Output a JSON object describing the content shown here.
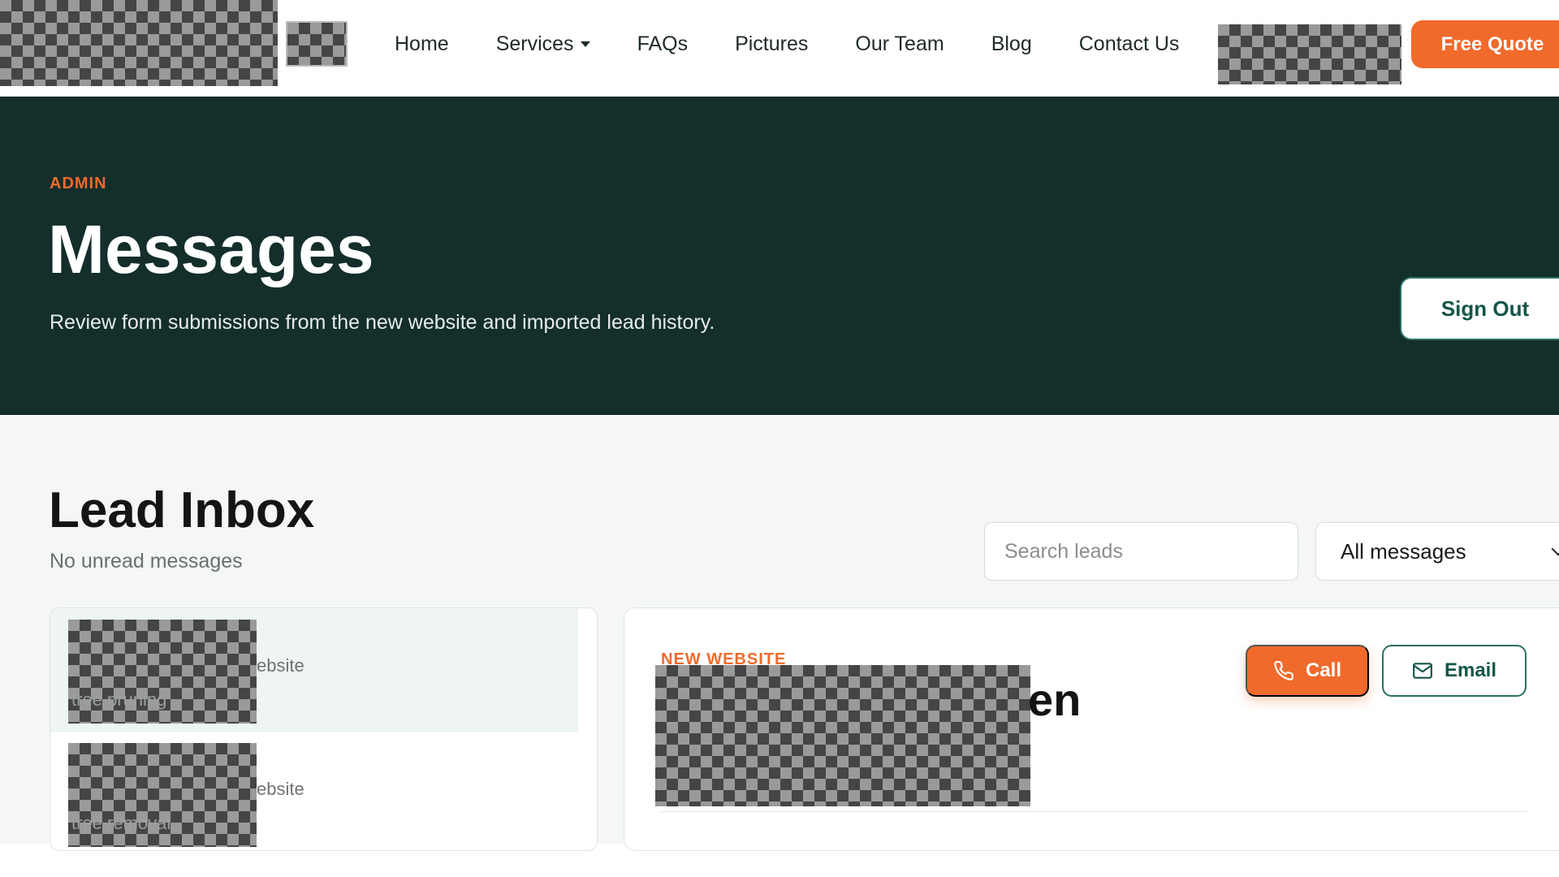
{
  "header": {
    "nav": [
      {
        "label": "Home"
      },
      {
        "label": "Services"
      },
      {
        "label": "FAQs"
      },
      {
        "label": "Pictures"
      },
      {
        "label": "Our Team"
      },
      {
        "label": "Blog"
      },
      {
        "label": "Contact Us"
      }
    ],
    "quote_label": "Free Quote"
  },
  "hero": {
    "kicker": "ADMIN",
    "title": "Messages",
    "subtitle": "Review form submissions from the new website and imported lead history.",
    "signout_label": "Sign Out"
  },
  "inbox": {
    "title": "Lead Inbox",
    "subtitle": "No unread messages",
    "search_placeholder": "Search leads",
    "filter_value": "All messages",
    "items": [
      {
        "source": "ebsite",
        "service": "tree pruning"
      },
      {
        "source": "ebsite",
        "service": "tree removal"
      }
    ]
  },
  "detail": {
    "kicker": "NEW WEBSITE",
    "name_tail": "en",
    "call_label": "Call",
    "email_label": "Email"
  },
  "colors": {
    "accent": "#f06a2b",
    "hero_bg": "#132e2b",
    "teal": "#145548"
  }
}
